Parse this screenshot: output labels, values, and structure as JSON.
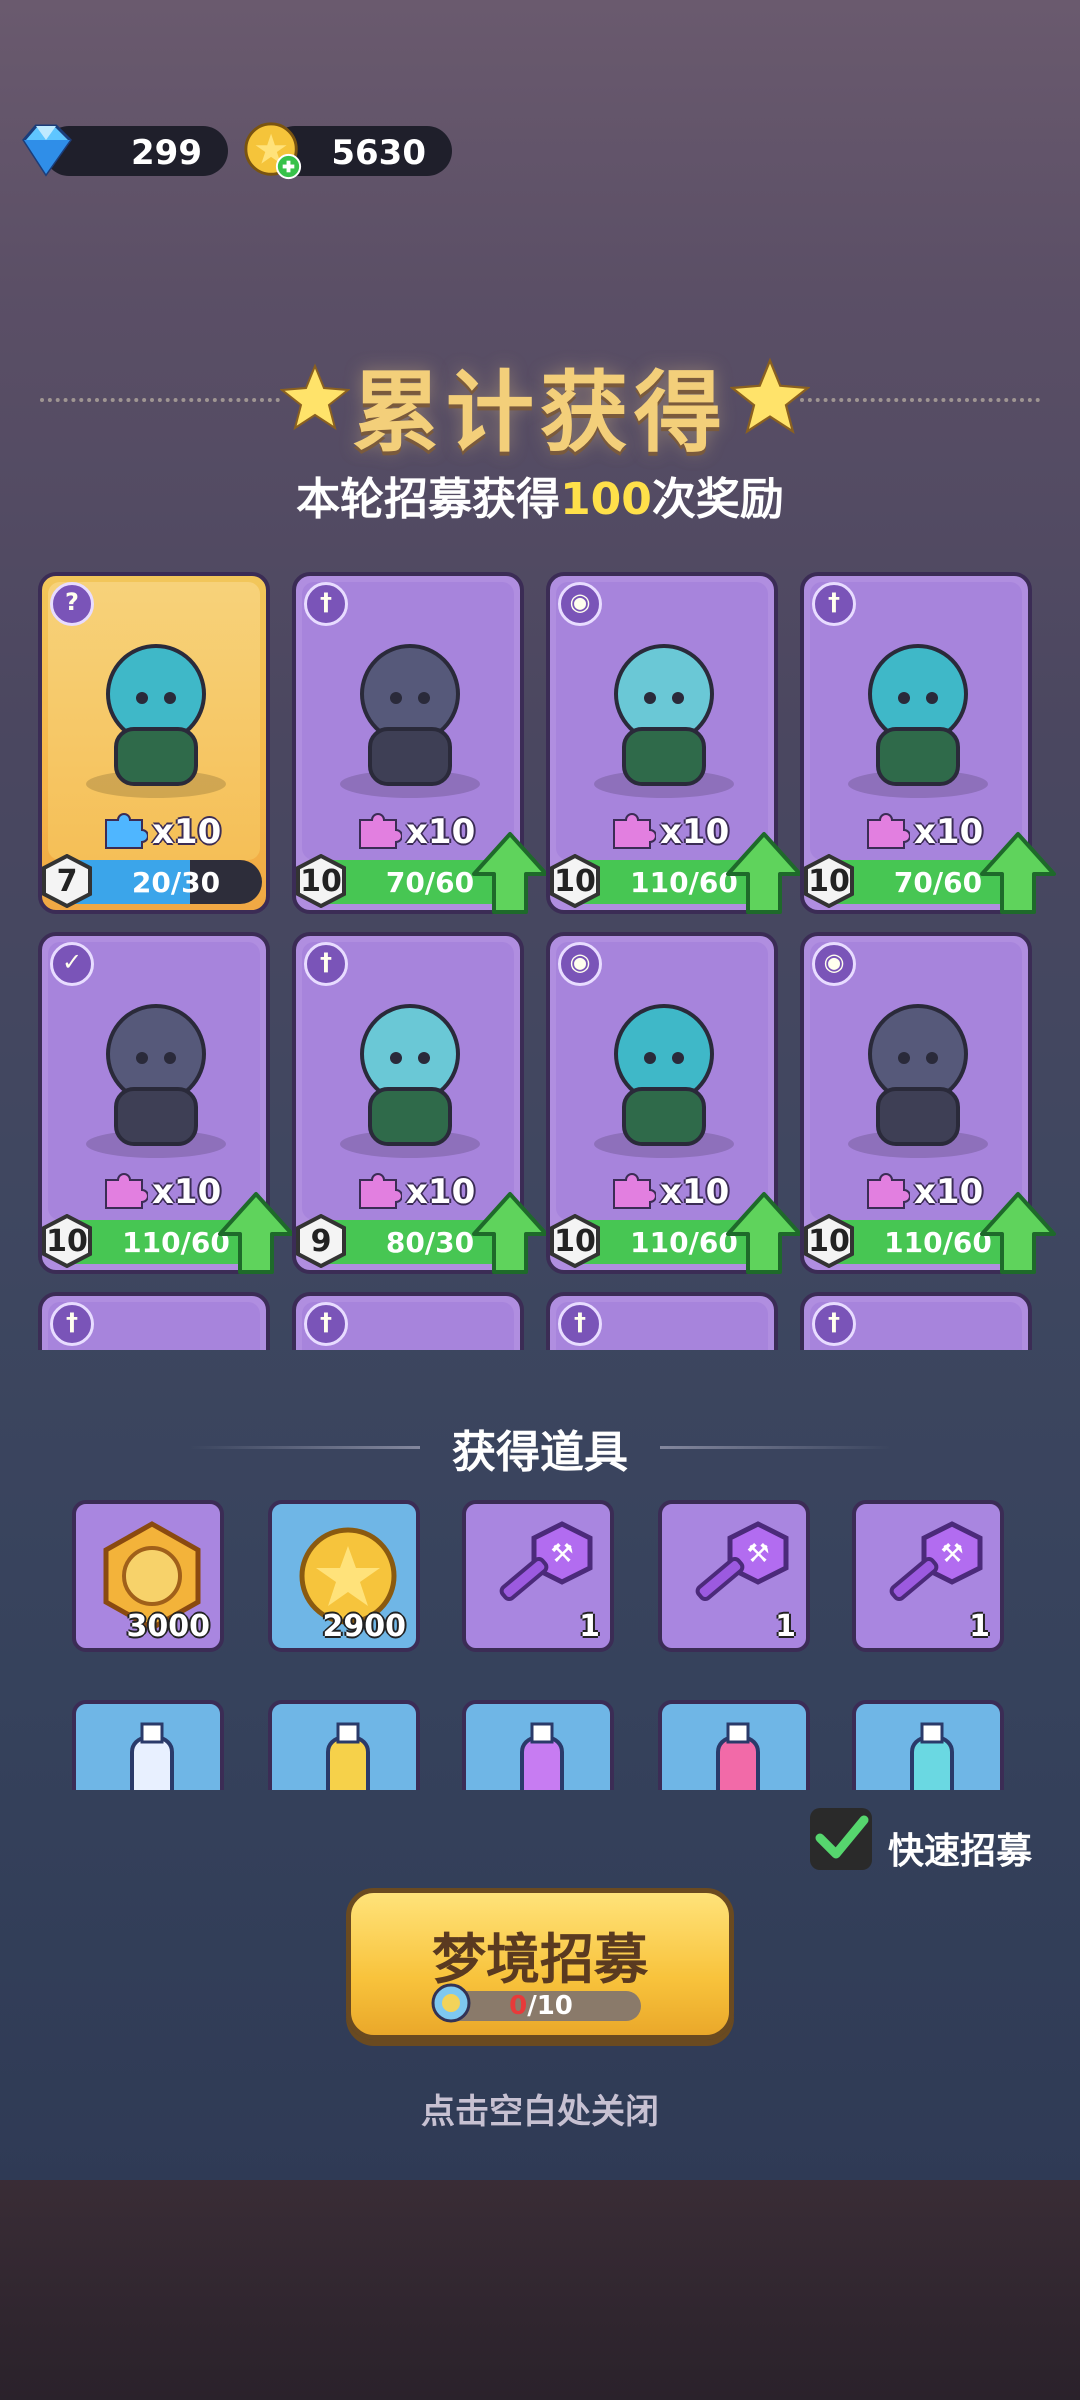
{
  "currency": {
    "gems": "299",
    "coins": "5630"
  },
  "header": {
    "title": "累计获得",
    "subtitle_prefix": "本轮招募获得",
    "subtitle_count": "100",
    "subtitle_suffix": "次奖励"
  },
  "heroes": [
    {
      "level": "7",
      "count": "x10",
      "progress": "20/30",
      "fill": 0.667,
      "rarity": "gold",
      "class_icon": "staff-icon",
      "upgrade": false
    },
    {
      "level": "10",
      "count": "x10",
      "progress": "70/60",
      "fill": 1.0,
      "rarity": "purple",
      "class_icon": "sword-icon",
      "upgrade": true
    },
    {
      "level": "10",
      "count": "x10",
      "progress": "110/60",
      "fill": 1.0,
      "rarity": "purple",
      "class_icon": "potion-icon",
      "upgrade": true
    },
    {
      "level": "10",
      "count": "x10",
      "progress": "70/60",
      "fill": 1.0,
      "rarity": "purple",
      "class_icon": "sword-icon",
      "upgrade": true
    },
    {
      "level": "10",
      "count": "x10",
      "progress": "110/60",
      "fill": 1.0,
      "rarity": "purple",
      "class_icon": "bow-icon",
      "upgrade": true
    },
    {
      "level": "9",
      "count": "x10",
      "progress": "80/30",
      "fill": 1.0,
      "rarity": "purple",
      "class_icon": "sword-icon",
      "upgrade": true
    },
    {
      "level": "10",
      "count": "x10",
      "progress": "110/60",
      "fill": 1.0,
      "rarity": "purple",
      "class_icon": "potion-icon",
      "upgrade": true
    },
    {
      "level": "10",
      "count": "x10",
      "progress": "110/60",
      "fill": 1.0,
      "rarity": "purple",
      "class_icon": "potion-icon",
      "upgrade": true
    }
  ],
  "items_section": {
    "title": "获得道具",
    "items": [
      {
        "name": "hero-medal",
        "qty": "3000",
        "bg": "purple"
      },
      {
        "name": "gold-coin",
        "qty": "2900",
        "bg": "blue"
      },
      {
        "name": "purple-key",
        "qty": "1",
        "bg": "purple"
      },
      {
        "name": "purple-key",
        "qty": "1",
        "bg": "purple"
      },
      {
        "name": "purple-key",
        "qty": "1",
        "bg": "purple"
      }
    ]
  },
  "quick_recruit": {
    "label": "快速招募",
    "checked": true
  },
  "recruit_button": {
    "label": "梦境招募",
    "progress_current": "0",
    "progress_total": "/10"
  },
  "close_tip": "点击空白处关闭"
}
